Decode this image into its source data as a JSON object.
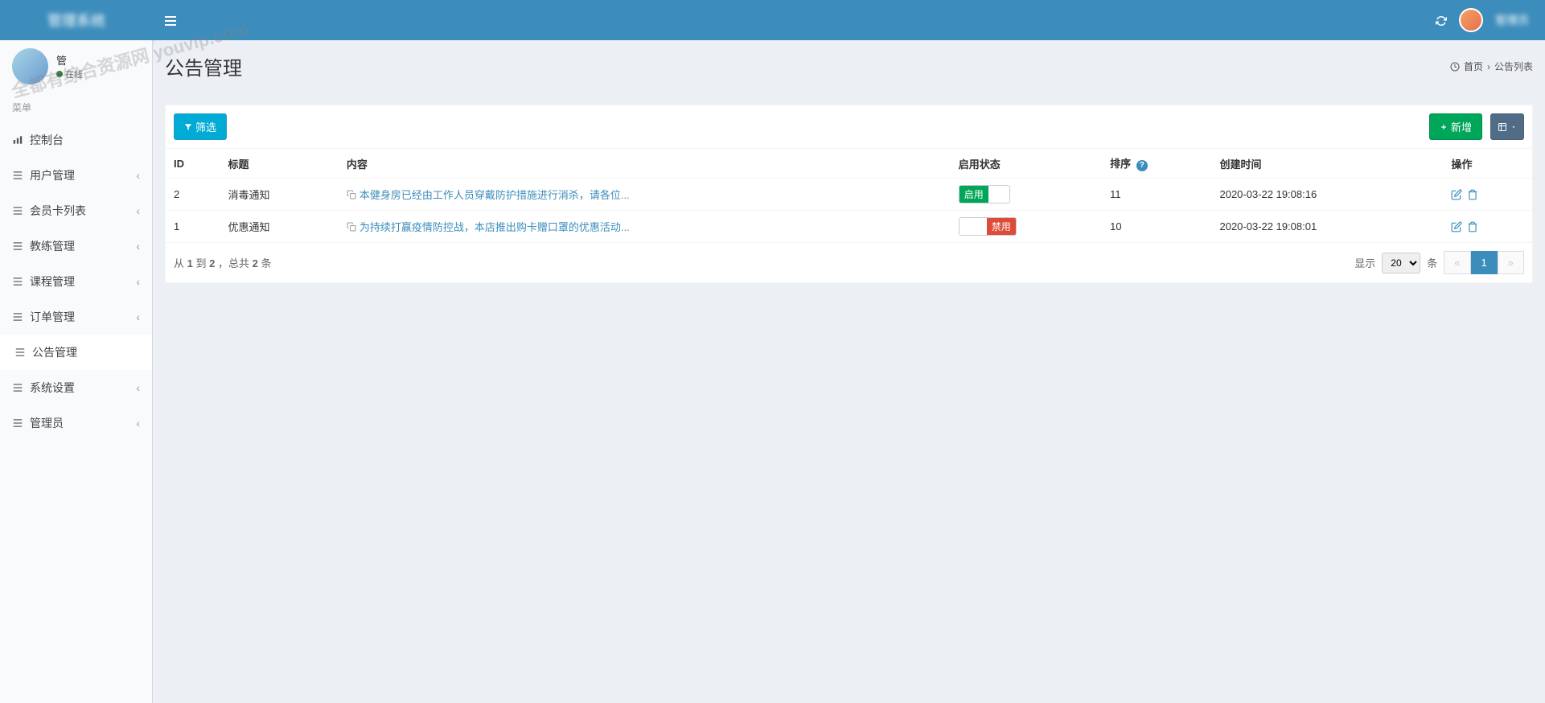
{
  "header": {
    "logo": "管理系统",
    "username": "管理员",
    "refresh_title": "刷新"
  },
  "sidebar": {
    "user_name": "管",
    "user_status": "在线",
    "menu_header": "菜单",
    "items": [
      {
        "label": "控制台",
        "icon": "bar-chart",
        "expandable": false
      },
      {
        "label": "用户管理",
        "icon": "list",
        "expandable": true
      },
      {
        "label": "会员卡列表",
        "icon": "list",
        "expandable": true
      },
      {
        "label": "教练管理",
        "icon": "list",
        "expandable": true
      },
      {
        "label": "课程管理",
        "icon": "list",
        "expandable": true
      },
      {
        "label": "订单管理",
        "icon": "list",
        "expandable": true
      },
      {
        "label": "公告管理",
        "icon": "list",
        "expandable": false,
        "active": true
      },
      {
        "label": "系统设置",
        "icon": "list",
        "expandable": true
      },
      {
        "label": "管理员",
        "icon": "list",
        "expandable": true
      }
    ]
  },
  "page": {
    "title": "公告管理",
    "breadcrumb_home": "首页",
    "breadcrumb_current": "公告列表"
  },
  "toolbar": {
    "filter_label": "筛选",
    "add_label": "新增"
  },
  "table": {
    "headers": {
      "id": "ID",
      "title": "标题",
      "content": "内容",
      "status": "启用状态",
      "sort": "排序",
      "created": "创建时间",
      "action": "操作"
    },
    "status_enable": "启用",
    "status_disable": "禁用",
    "rows": [
      {
        "id": "2",
        "title": "消毒通知",
        "content": "本健身房已经由工作人员穿戴防护措施进行消杀，请各位...",
        "enabled": true,
        "sort": "11",
        "created": "2020-03-22 19:08:16"
      },
      {
        "id": "1",
        "title": "优惠通知",
        "content": "为持续打赢疫情防控战，本店推出购卡赠口罩的优惠活动...",
        "enabled": false,
        "sort": "10",
        "created": "2020-03-22 19:08:01"
      }
    ]
  },
  "footer": {
    "info_prefix": "从",
    "info_from": "1",
    "info_mid": "到",
    "info_to": "2",
    "info_total_prefix": "，总共",
    "info_total": "2",
    "info_suffix": "条",
    "show_label": "显示",
    "page_size": "20",
    "unit": "条",
    "current_page": "1"
  },
  "watermark": "全都有综合资源网\nyouvip.com"
}
